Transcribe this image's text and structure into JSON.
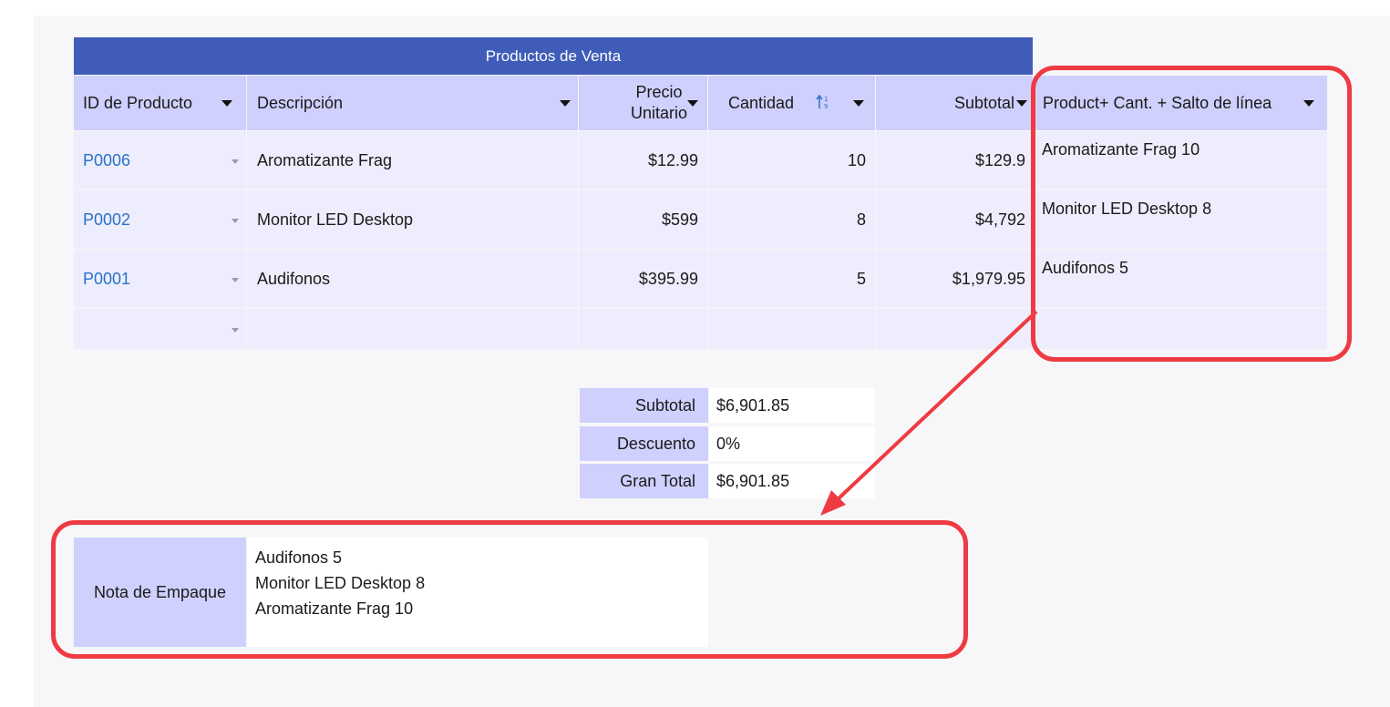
{
  "table": {
    "title": "Productos de Venta",
    "headers": {
      "id": "ID de Producto",
      "descripcion": "Descripción",
      "precio_line1": "Precio",
      "precio_line2": "Unitario",
      "cantidad": "Cantidad",
      "subtotal": "Subtotal",
      "product_cant": "Product+ Cant. + Salto de línea"
    },
    "rows": [
      {
        "id": "P0006",
        "descripcion": "Aromatizante Frag",
        "precio": "$12.99",
        "cantidad": "10",
        "subtotal": "$129.9",
        "product_cant": "Aromatizante Frag 10"
      },
      {
        "id": "P0002",
        "descripcion": "Monitor LED Desktop",
        "precio": "$599",
        "cantidad": "8",
        "subtotal": "$4,792",
        "product_cant": "Monitor LED Desktop 8"
      },
      {
        "id": "P0001",
        "descripcion": "Audifonos",
        "precio": "$395.99",
        "cantidad": "5",
        "subtotal": "$1,979.95",
        "product_cant": "Audifonos 5"
      }
    ]
  },
  "summary": {
    "subtotal_label": "Subtotal",
    "subtotal_value": "$6,901.85",
    "descuento_label": "Descuento",
    "descuento_value": "0%",
    "gran_total_label": "Gran Total",
    "gran_total_value": "$6,901.85"
  },
  "nota": {
    "label": "Nota de Empaque",
    "lines": [
      "Audifonos 5",
      "Monitor LED Desktop 8",
      "Aromatizante Frag 10"
    ]
  },
  "colors": {
    "title_bar": "#3f5cb8",
    "header_bg": "#cfd0fd",
    "row_bg": "#ededfd",
    "link": "#2b72c8",
    "annotation_red": "#ee3b42"
  }
}
